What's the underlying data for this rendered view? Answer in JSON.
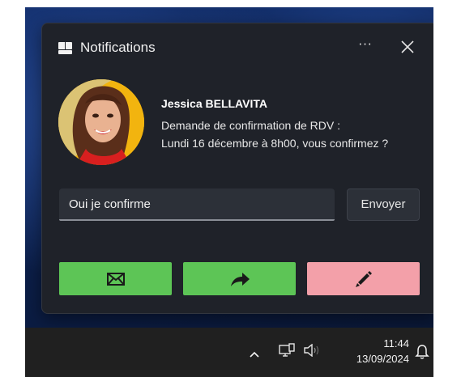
{
  "notification": {
    "title": "Notifications",
    "more_label": "···",
    "sender": "Jessica BELLAVITA",
    "message_line1": "Demande de confirmation de RDV :",
    "message_line2": "Lundi 16 décembre à 8h00, vous confirmez ?",
    "reply_value": "Oui je confirme",
    "send_label": "Envoyer",
    "actions": [
      {
        "icon": "envelope-icon",
        "color": "#5dc556"
      },
      {
        "icon": "forward-arrow-icon",
        "color": "#5dc556"
      },
      {
        "icon": "pencil-icon",
        "color": "#f3a0a9"
      }
    ]
  },
  "taskbar": {
    "time": "11:44",
    "date": "13/09/2024",
    "icons": [
      "chevron-up-icon",
      "network-icon",
      "speaker-icon",
      "bell-icon"
    ]
  }
}
